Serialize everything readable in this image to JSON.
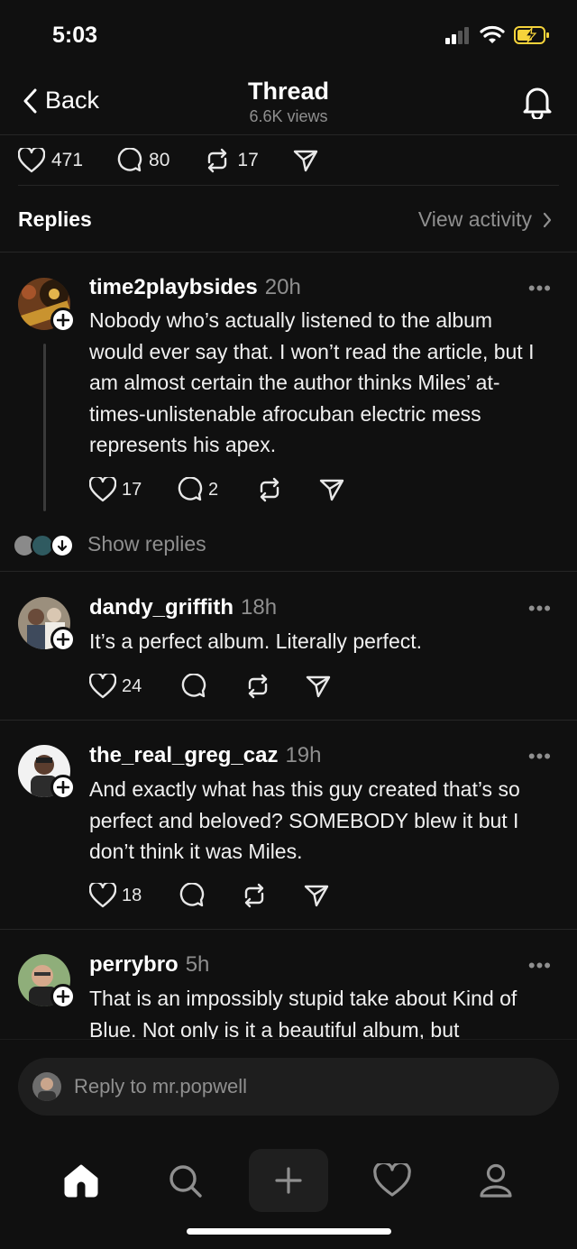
{
  "status": {
    "time": "5:03"
  },
  "header": {
    "back_label": "Back",
    "title": "Thread",
    "subtitle": "6.6K views"
  },
  "stats": {
    "likes": "471",
    "comments": "80",
    "reposts": "17"
  },
  "replies": {
    "label": "Replies",
    "view_activity": "View activity"
  },
  "posts": [
    {
      "username": "time2playbsides",
      "time": "20h",
      "text": "Nobody who’s actually listened to the album would ever say that. I won’t read the article, but I am almost certain the author thinks Miles’ at-times-unlistenable afrocuban electric mess represents his apex.",
      "likes": "17",
      "comments": "2"
    },
    {
      "username": "dandy_griffith",
      "time": "18h",
      "text": "It’s a perfect album. Literally perfect.",
      "likes": "24",
      "comments": ""
    },
    {
      "username": "the_real_greg_caz",
      "time": "19h",
      "text": "And exactly what has this guy created that’s so perfect and beloved? SOMEBODY blew it but I don’t think it was Miles.",
      "likes": "18",
      "comments": ""
    },
    {
      "username": "perrybro",
      "time": "5h",
      "text": "That is an impossibly stupid take about Kind of Blue. Not only is it a beautiful album, but",
      "likes": "",
      "comments": ""
    }
  ],
  "show_replies": "Show replies",
  "reply_bar": {
    "placeholder": "Reply to mr.popwell"
  },
  "more_label": "•••",
  "colors": {
    "background": "#101010",
    "text": "#f3f3f3",
    "muted": "#8f8f8f",
    "divider": "#262626",
    "battery": "#f5d33b"
  },
  "icons": [
    "chevron-left-icon",
    "bell-icon",
    "heart-icon",
    "comment-icon",
    "repost-icon",
    "share-icon",
    "home-icon",
    "search-icon",
    "plus-icon",
    "profile-icon"
  ]
}
